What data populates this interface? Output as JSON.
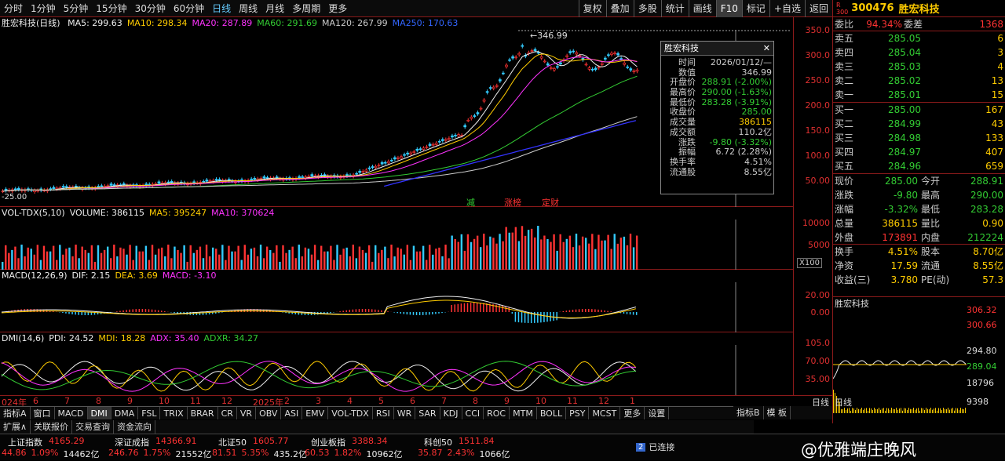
{
  "toolbar": {
    "periods": [
      "分时",
      "1分钟",
      "5分钟",
      "15分钟",
      "30分钟",
      "60分钟",
      "日线",
      "周线",
      "月线",
      "多周期",
      "更多"
    ],
    "active": "日线",
    "tools": [
      "复权",
      "叠加",
      "多股",
      "统计",
      "画线",
      "F10",
      "标记",
      "+自选",
      "返回"
    ]
  },
  "main": {
    "title": "胜宏科技(日线)",
    "ma": [
      {
        "label": "MA5: 299.63",
        "color": "#eeeeee"
      },
      {
        "label": "MA10: 298.34",
        "color": "#ffcc00"
      },
      {
        "label": "MA20: 287.89",
        "color": "#ff33ff"
      },
      {
        "label": "MA60: 291.69",
        "color": "#33cc33"
      },
      {
        "label": "MA120: 267.99",
        "color": "#cccccc"
      },
      {
        "label": "MA250: 170.63",
        "color": "#3366ff"
      }
    ],
    "y_ticks": [
      "350.0",
      "300.0",
      "250.0",
      "200.0",
      "150.0",
      "100.0",
      "50.00"
    ],
    "high_label": "346.99",
    "low_label": "25.00",
    "events": [
      "减",
      "涨榜",
      "定财"
    ]
  },
  "popup": {
    "title": "胜宏科技",
    "rows": [
      {
        "k": "时间",
        "v": "2026/01/12/—",
        "c": "#cccccc"
      },
      {
        "k": "数值",
        "v": "346.99",
        "c": "#cccccc"
      },
      {
        "k": "开盘价",
        "v": "288.91 (-2.00%)",
        "c": "#33cc33"
      },
      {
        "k": "最高价",
        "v": "290.00 (-1.63%)",
        "c": "#33cc33"
      },
      {
        "k": "最低价",
        "v": "283.28 (-3.91%)",
        "c": "#33cc33"
      },
      {
        "k": "收盘价",
        "v": "285.00",
        "c": "#33cc33"
      },
      {
        "k": "成交量",
        "v": "386115",
        "c": "#ffcc00"
      },
      {
        "k": "成交额",
        "v": "110.2亿",
        "c": "#cccccc"
      },
      {
        "k": "涨跌",
        "v": "-9.80 (-3.32%)",
        "c": "#33cc33"
      },
      {
        "k": "振幅",
        "v": "6.72 (2.28%)",
        "c": "#cccccc"
      },
      {
        "k": "换手率",
        "v": "4.51%",
        "c": "#cccccc"
      },
      {
        "k": "流通股",
        "v": "8.55亿",
        "c": "#cccccc"
      }
    ]
  },
  "vol": {
    "title": "VOL-TDX(5,10)",
    "items": [
      "VOLUME: 386115",
      "MA5: 395247",
      "MA10: 370624"
    ],
    "ticks": [
      "10000",
      "5000"
    ],
    "unit": "X100"
  },
  "macd": {
    "title": "MACD(12,26,9)",
    "items": [
      "DIF: 2.15",
      "DEA: 3.69",
      "MACD: -3.10"
    ],
    "ticks": [
      "20.00",
      "0.00"
    ]
  },
  "dmi": {
    "title": "DMI(14,6)",
    "items": [
      "PDI: 24.52",
      "MDI: 18.28",
      "ADX: 35.40",
      "ADXR: 34.27"
    ],
    "ticks": [
      "105.0",
      "70.00",
      "35.00"
    ]
  },
  "xaxis": [
    "024年",
    "6",
    "7",
    "8",
    "9",
    "10",
    "11",
    "12",
    "2025年",
    "2",
    "3",
    "4",
    "5",
    "6",
    "7",
    "8",
    "9",
    "10",
    "11",
    "12",
    "1"
  ],
  "tabs": [
    "指标A",
    "窗口",
    "MACD",
    "DMI",
    "DMA",
    "FSL",
    "TRIX",
    "BRAR",
    "CR",
    "VR",
    "OBV",
    "ASI",
    "EMV",
    "VOL-TDX",
    "RSI",
    "WR",
    "SAR",
    "KDJ",
    "CCI",
    "ROC",
    "MTM",
    "BOLL",
    "PSY",
    "MCST",
    "更多",
    "设置"
  ],
  "tabs_right": [
    "指标B",
    "模 板"
  ],
  "tabs2": [
    "扩展∧",
    "关联报价",
    "交易查询",
    "资金流向"
  ],
  "right": {
    "code": "300476",
    "name": "胜宏科技",
    "weibi": {
      "k": "委比",
      "v": "94.34%",
      "k2": "委差",
      "v2": "1368"
    },
    "sell": [
      {
        "k": "卖五",
        "p": "285.05",
        "q": "6"
      },
      {
        "k": "卖四",
        "p": "285.04",
        "q": "3"
      },
      {
        "k": "卖三",
        "p": "285.03",
        "q": "4"
      },
      {
        "k": "卖二",
        "p": "285.02",
        "q": "13"
      },
      {
        "k": "卖一",
        "p": "285.01",
        "q": "15"
      }
    ],
    "buy": [
      {
        "k": "买一",
        "p": "285.00",
        "q": "167"
      },
      {
        "k": "买二",
        "p": "284.99",
        "q": "43"
      },
      {
        "k": "买三",
        "p": "284.98",
        "q": "133"
      },
      {
        "k": "买四",
        "p": "284.97",
        "q": "407"
      },
      {
        "k": "买五",
        "p": "284.96",
        "q": "659"
      }
    ],
    "stats": [
      {
        "k": "现价",
        "v": "285.00",
        "vc": "#33cc33",
        "k2": "今开",
        "v2": "288.91",
        "v2c": "#33cc33"
      },
      {
        "k": "涨跌",
        "v": "-9.80",
        "vc": "#33cc33",
        "k2": "最高",
        "v2": "290.00",
        "v2c": "#33cc33"
      },
      {
        "k": "涨幅",
        "v": "-3.32%",
        "vc": "#33cc33",
        "k2": "最低",
        "v2": "283.28",
        "v2c": "#33cc33"
      },
      {
        "k": "总量",
        "v": "386115",
        "vc": "#ffcc00",
        "k2": "量比",
        "v2": "0.90",
        "v2c": "#ffcc00"
      },
      {
        "k": "外盘",
        "v": "173891",
        "vc": "#ff3333",
        "k2": "内盘",
        "v2": "212224",
        "v2c": "#33cc33"
      },
      {
        "k": "换手",
        "v": "4.51%",
        "vc": "#ffcc00",
        "k2": "股本",
        "v2": "8.70亿",
        "v2c": "#ffcc00"
      },
      {
        "k": "净资",
        "v": "17.59",
        "vc": "#ffcc00",
        "k2": "流通",
        "v2": "8.55亿",
        "v2c": "#ffcc00"
      },
      {
        "k": "收益(三)",
        "v": "3.780",
        "vc": "#ffcc00",
        "k2": "PE(动)",
        "v2": "57.3",
        "v2c": "#ffcc00"
      }
    ],
    "mini": {
      "title": "胜宏科技",
      "ticks": [
        "306.32",
        "300.66",
        "294.80",
        "289.04",
        "18796",
        "9398"
      ],
      "label": "日线"
    }
  },
  "status": {
    "indices": [
      {
        "name": "上证指数",
        "val": "4165.29",
        "chg": "44.86",
        "pct": "1.09%",
        "amt": "14462亿"
      },
      {
        "name": "深证成指",
        "val": "14366.91",
        "chg": "246.76",
        "pct": "1.75%",
        "amt": "21552亿"
      },
      {
        "name": "北证50",
        "val": "1605.77",
        "chg": "81.51",
        "pct": "5.35%",
        "amt": "435.2亿"
      },
      {
        "name": "创业板指",
        "val": "3388.34",
        "chg": "60.53",
        "pct": "1.82%",
        "amt": "10962亿"
      },
      {
        "name": "科创50",
        "val": "1511.84",
        "chg": "35.87",
        "pct": "2.43%",
        "amt": "1066亿"
      }
    ],
    "conn": "已连接",
    "conn_num": "2",
    "watermark": "@优雅端庄晚风"
  }
}
